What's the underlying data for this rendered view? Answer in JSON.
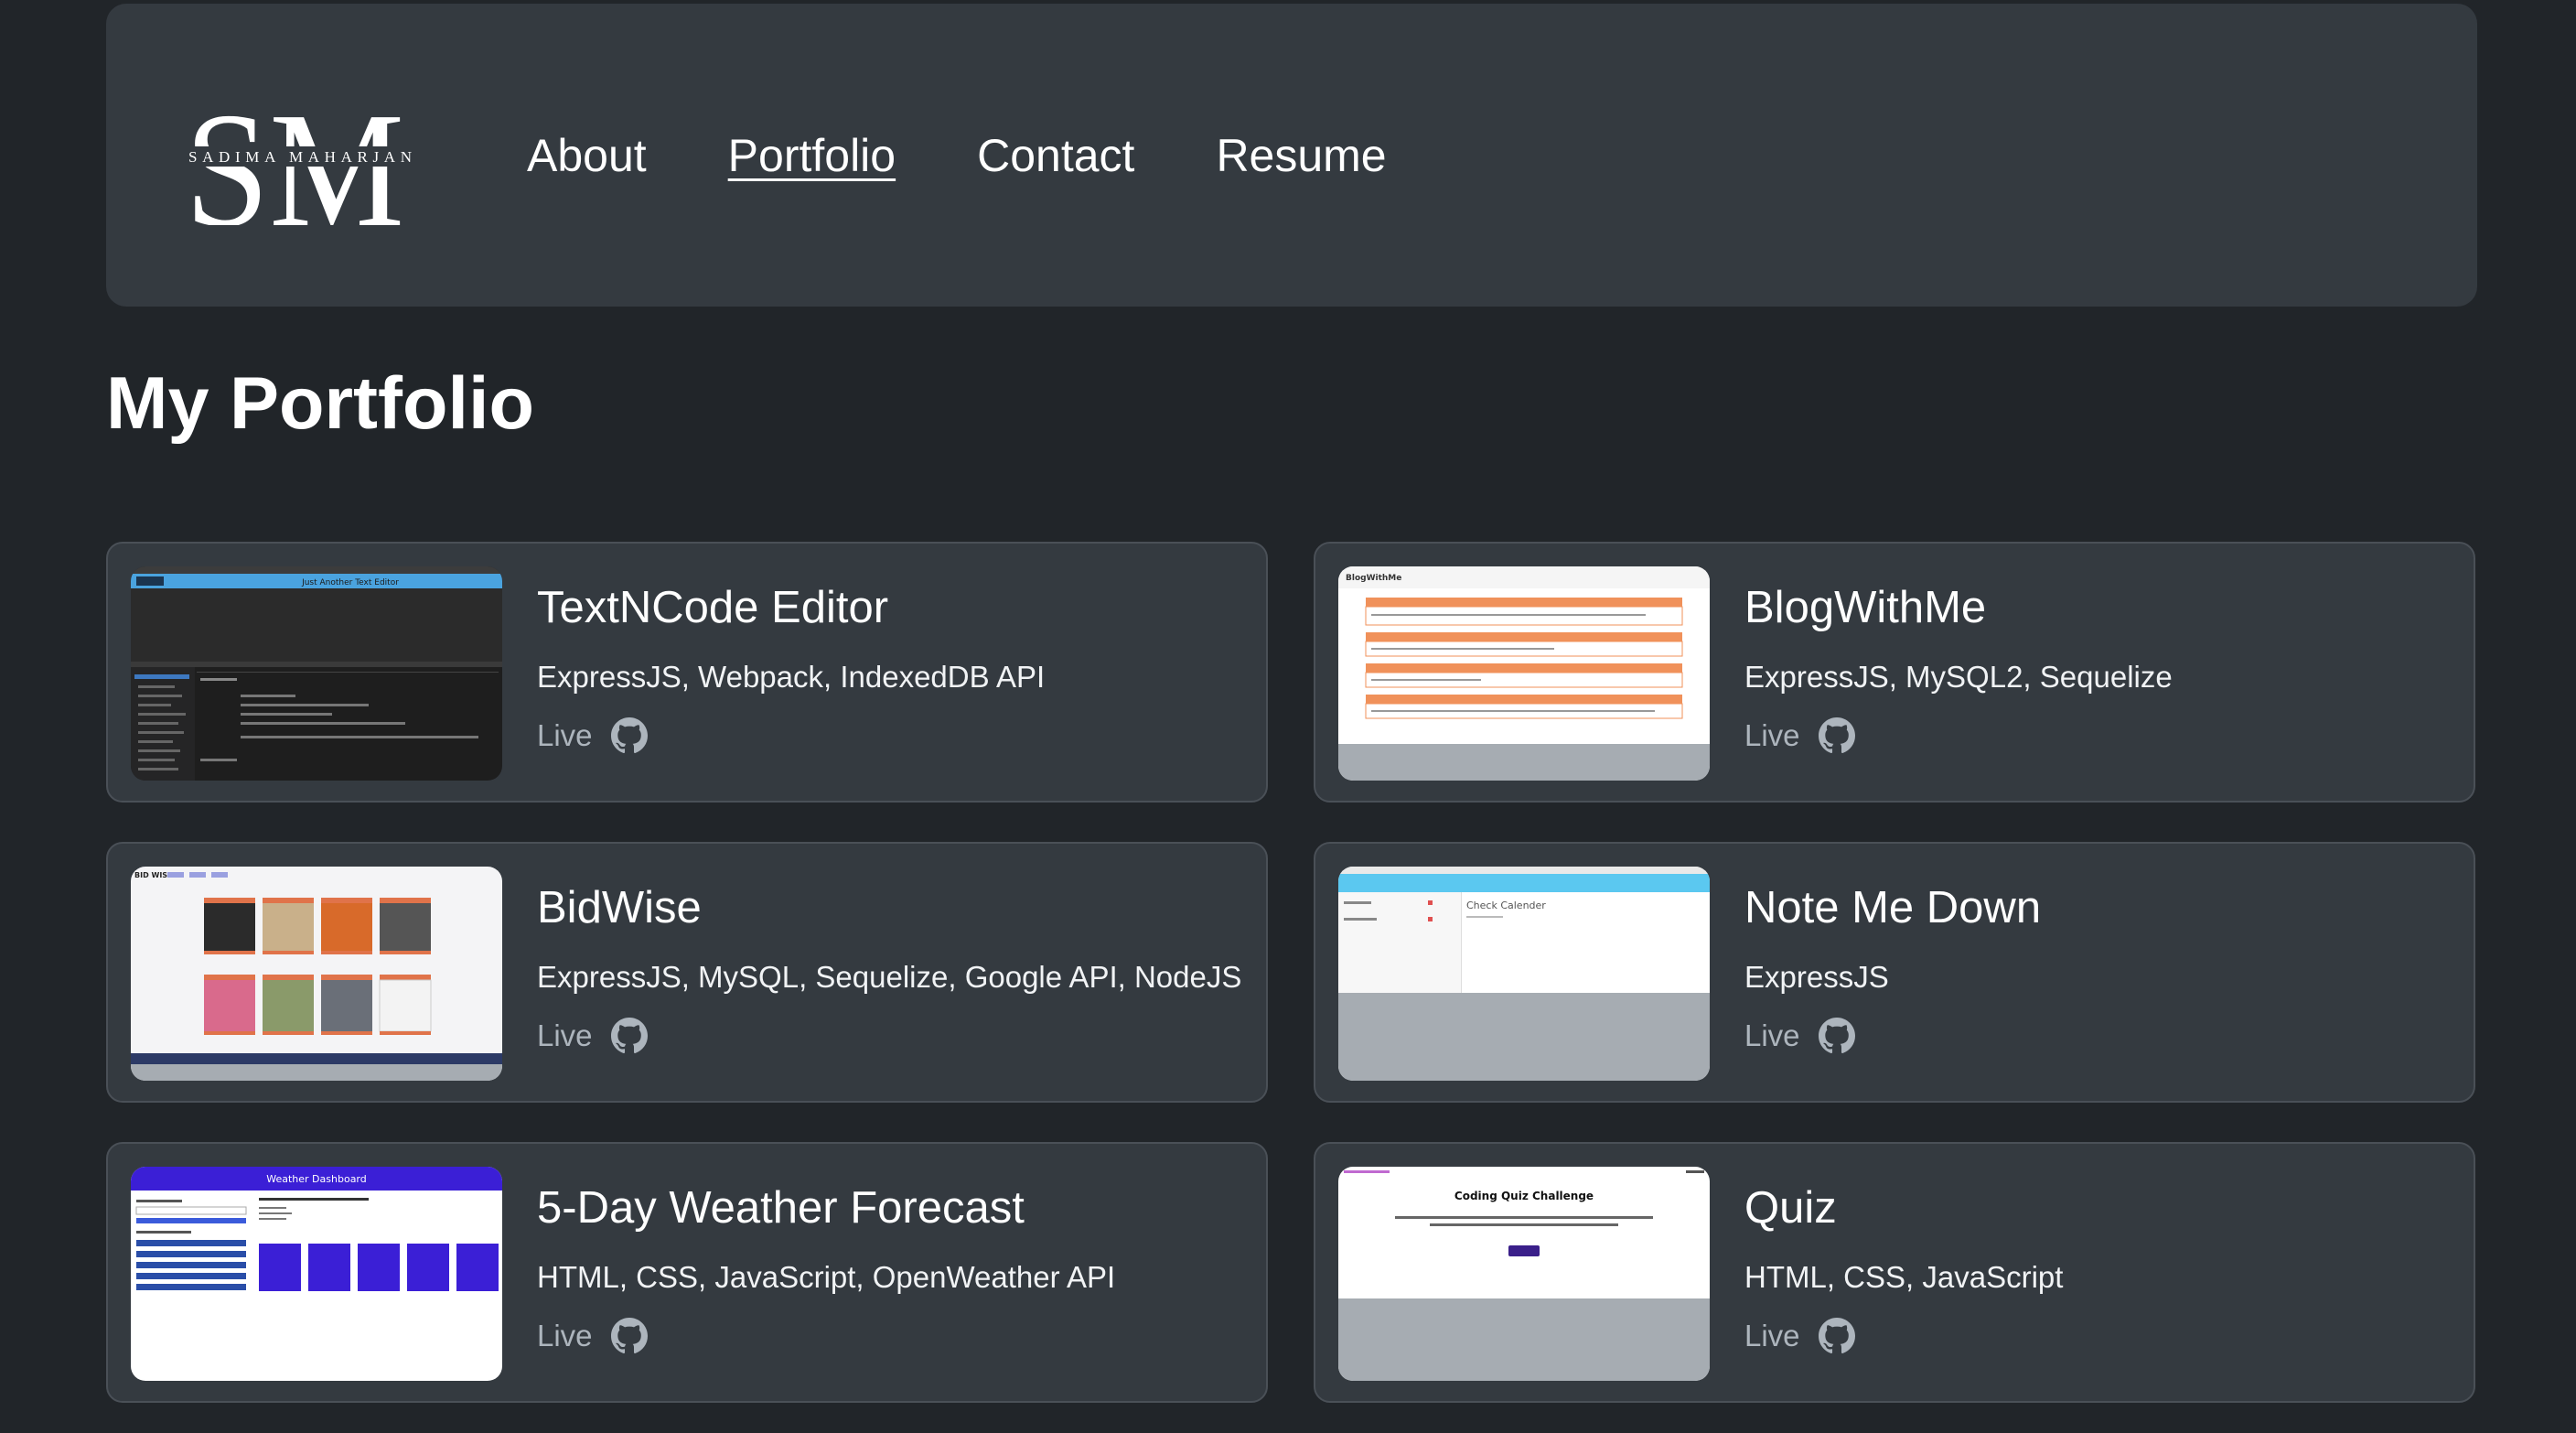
{
  "logo": {
    "initials": "SM",
    "name": "SADIMA MAHARJAN"
  },
  "nav": {
    "items": [
      {
        "label": "About"
      },
      {
        "label": "Portfolio"
      },
      {
        "label": "Contact"
      },
      {
        "label": "Resume"
      }
    ]
  },
  "main": {
    "title": "My Portfolio",
    "projects": [
      {
        "title": "TextNCode Editor",
        "tech": "ExpressJS, Webpack, IndexedDB API",
        "live_label": "Live",
        "icon": "github-icon",
        "thumb_caption": "Just Another Text Editor"
      },
      {
        "title": "BlogWithMe",
        "tech": "ExpressJS, MySQL2, Sequelize",
        "live_label": "Live",
        "icon": "github-icon",
        "thumb_caption": "BlogWithMe"
      },
      {
        "title": "BidWise",
        "tech": "ExpressJS, MySQL, Sequelize, Google API, NodeJS",
        "live_label": "Live",
        "icon": "github-icon",
        "thumb_caption": "BID WISE"
      },
      {
        "title": "Note Me Down",
        "tech": "ExpressJS",
        "live_label": "Live",
        "icon": "github-icon",
        "thumb_caption": "Check Calender"
      },
      {
        "title": "5-Day Weather Forecast",
        "tech": "HTML, CSS, JavaScript, OpenWeather API",
        "live_label": "Live",
        "icon": "github-icon",
        "thumb_caption": "Weather Dashboard"
      },
      {
        "title": "Quiz",
        "tech": "HTML, CSS, JavaScript",
        "live_label": "Live",
        "icon": "github-icon",
        "thumb_caption": "Coding Quiz Challenge"
      }
    ]
  },
  "colors": {
    "background": "#212529",
    "panel": "#343a40",
    "muted_link": "#adb5bd",
    "weather_accent": "#3b1fd6",
    "blog_accent": "#f0915a",
    "note_accent": "#5bc8f0"
  }
}
